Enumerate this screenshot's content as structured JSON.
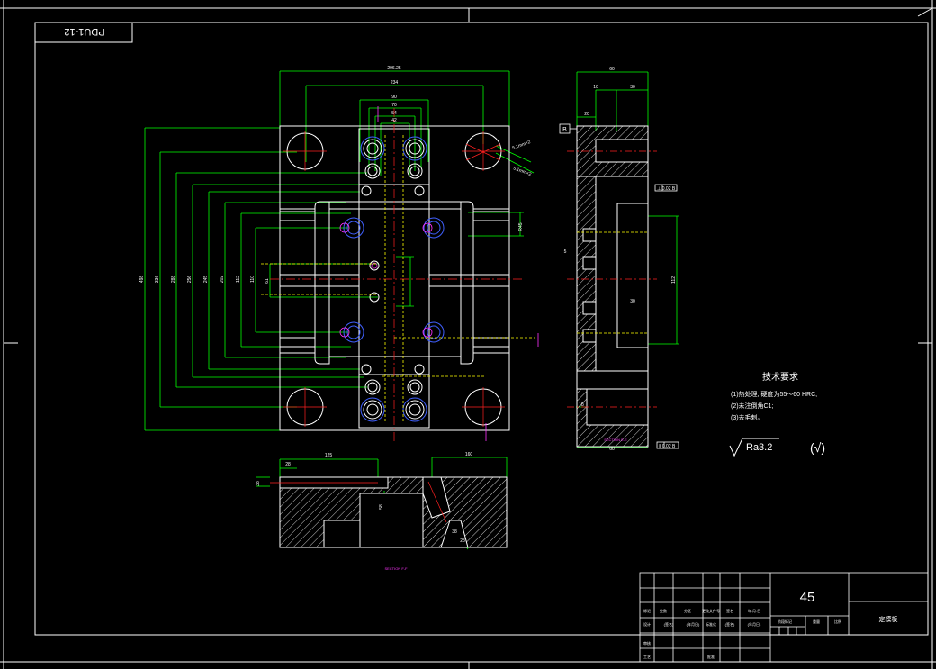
{
  "drawing": {
    "code": "PDU1-12",
    "material": "45",
    "part_name": "定模板",
    "colors": {
      "background": "#000000",
      "outline": "#ffffff",
      "dimension": "#00ff00",
      "centerline": "#ff2020",
      "hidden": "#ffff00",
      "hole": "#4060ff",
      "section_label": "#ff33ff"
    }
  },
  "tech_requirements": {
    "title": "技术要求",
    "items": [
      "(1)热处理, 硬度为55～60 HRC;",
      "(2)未注倒角C1;",
      "(3)去毛刺。"
    ]
  },
  "roughness": {
    "value": "Ra3.2",
    "other": "(√)"
  },
  "section_labels": {
    "side": "SECTION E-E",
    "bottom": "SECTION F-F"
  },
  "datum": {
    "b": "B",
    "tol1": "⊥ 0.02 B",
    "tol2": "∥ 0.02 B"
  },
  "dims_top": [
    "296.25",
    "234",
    "90",
    "70",
    "54",
    "42"
  ],
  "dims_left": [
    "498",
    "336",
    "288",
    "256",
    "245",
    "202",
    "112",
    "110",
    "61"
  ],
  "dims_side": [
    "60",
    "10",
    "30",
    "20",
    "112",
    "30",
    "18",
    "60",
    "5"
  ],
  "dims_bottom": [
    "125",
    "28",
    "160",
    "58",
    "38",
    "38",
    "28"
  ],
  "dims_misc": [
    "5.1mm×2",
    "5.1mm×2",
    "R45"
  ],
  "title_block": {
    "r1": [
      "标记",
      "处数",
      "分区",
      "更改文件号",
      "签名",
      "年.月.日"
    ],
    "r2": [
      "设计",
      "(签名)",
      "(年月日)",
      "标准化",
      "(签名)",
      "(年月日)"
    ],
    "r2b": [
      "阶段标记",
      "重量",
      "比例"
    ],
    "r3": [
      "审核"
    ],
    "r4": [
      "工艺",
      "批准"
    ]
  }
}
